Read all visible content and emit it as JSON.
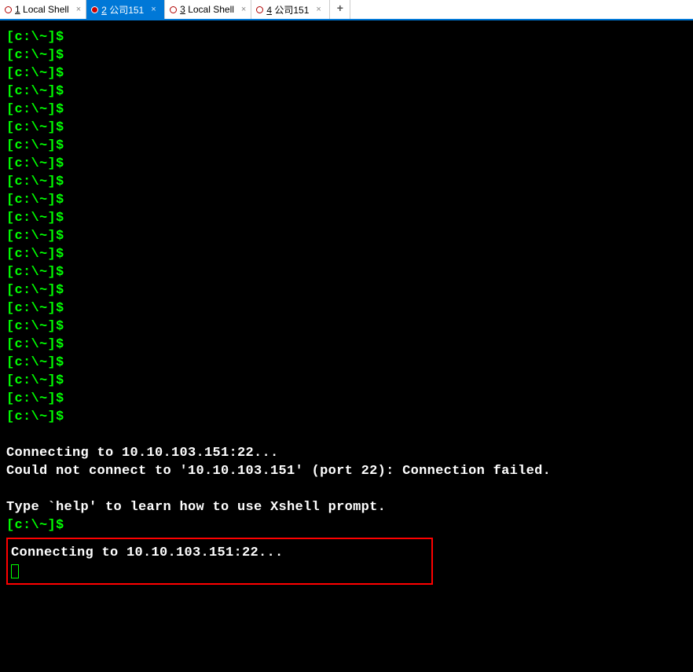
{
  "tabs": [
    {
      "num": "1",
      "label": " Local Shell",
      "active": false
    },
    {
      "num": "2",
      "label": " 公司151",
      "active": true
    },
    {
      "num": "3",
      "label": " Local Shell",
      "active": false
    },
    {
      "num": "4",
      "label": " 公司151",
      "active": false
    }
  ],
  "addTab": "+",
  "closeGlyph": "×",
  "promptText": "[c:\\~]$",
  "promptCount": 22,
  "messages": {
    "connecting": "Connecting to 10.10.103.151:22...",
    "failed": "Could not connect to '10.10.103.151' (port 22): Connection failed.",
    "help": "Type `help' to learn how to use Xshell prompt."
  },
  "boxedConnecting": "Connecting to 10.10.103.151:22..."
}
